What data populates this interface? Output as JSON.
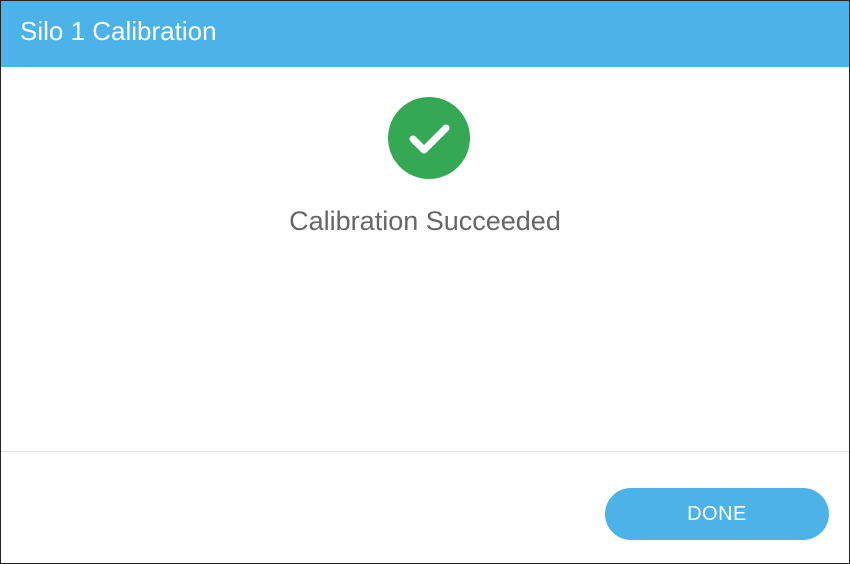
{
  "dialog": {
    "title": "Silo 1 Calibration",
    "status": {
      "icon": "check-circle-icon",
      "icon_color": "#35a853",
      "message": "Calibration Succeeded"
    },
    "footer": {
      "done_label": "DONE"
    }
  },
  "colors": {
    "header_background": "#4cb3e8",
    "button_background": "#4cb3e8",
    "text_secondary": "#666666"
  }
}
